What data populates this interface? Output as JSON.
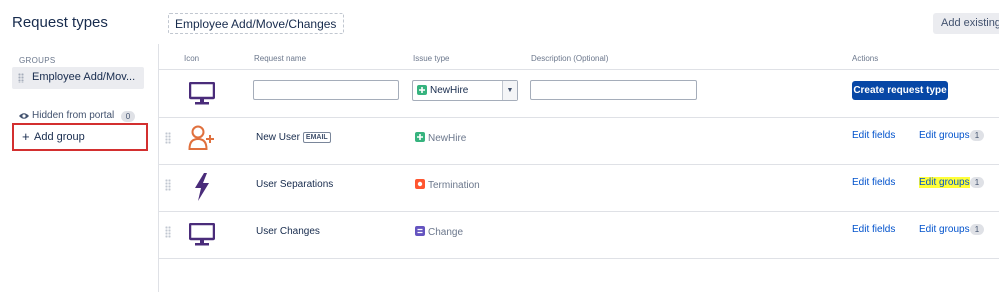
{
  "page": {
    "title": "Request types"
  },
  "group_editor": {
    "name": "Employee Add/Move/Changes",
    "add_existing_label": "Add existing re"
  },
  "sidebar": {
    "groups_heading": "GROUPS",
    "selected_group": "Employee Add/Mov...",
    "hidden_from_portal": {
      "label": "Hidden from portal",
      "count": "0"
    },
    "add_group_label": "Add group"
  },
  "table": {
    "headers": {
      "icon": "Icon",
      "request_name": "Request name",
      "issue_type": "Issue type",
      "description": "Description (Optional)",
      "actions": "Actions"
    },
    "new_row": {
      "issue_type": "NewHire",
      "create_label": "Create request type"
    },
    "rows": [
      {
        "icon": "person-add-icon",
        "name": "New User",
        "badge": "EMAIL",
        "issue_type": "NewHire",
        "issue_color": "#36b37e",
        "edit_fields": "Edit fields",
        "edit_groups": "Edit groups",
        "group_count": "1"
      },
      {
        "icon": "lightning-bolt-icon",
        "name": "User Separations",
        "badge": "",
        "issue_type": "Termination",
        "issue_color": "#ff5630",
        "edit_fields": "Edit fields",
        "edit_groups": "Edit groups",
        "group_count": "1"
      },
      {
        "icon": "monitor-icon",
        "name": "User Changes",
        "badge": "",
        "issue_type": "Change",
        "issue_color": "#6554c0",
        "edit_fields": "Edit fields",
        "edit_groups": "Edit groups",
        "group_count": "1"
      }
    ]
  },
  "colors": {
    "primary": "#0747a6",
    "link": "#0052cc",
    "highlight": "#ffff38",
    "callout": "#d32f2f",
    "icon_purple": "#4a2c7a",
    "icon_orange": "#e0703d"
  }
}
